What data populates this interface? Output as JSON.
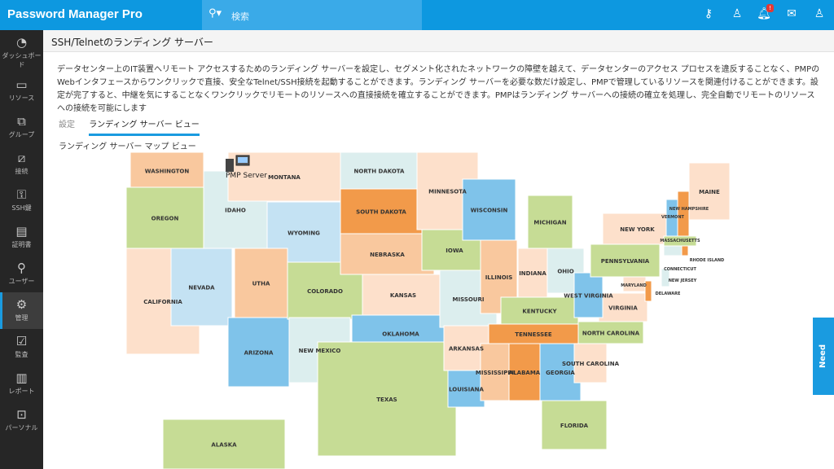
{
  "header": {
    "logo": "Password Manager Pro",
    "search_placeholder": "検索",
    "notification_count": "!"
  },
  "sidebar": {
    "items": [
      {
        "label": "ダッシュボード",
        "icon": "dashboard-icon",
        "glyph": "◔"
      },
      {
        "label": "リソース",
        "icon": "monitor-icon",
        "glyph": "▭"
      },
      {
        "label": "グループ",
        "icon": "groups-icon",
        "glyph": "⧉"
      },
      {
        "label": "接続",
        "icon": "connection-icon",
        "glyph": "⧄"
      },
      {
        "label": "SSH鍵",
        "icon": "ssh-key-icon",
        "glyph": "⚿"
      },
      {
        "label": "証明書",
        "icon": "certificate-icon",
        "glyph": "▤"
      },
      {
        "label": "ユーザー",
        "icon": "user-icon",
        "glyph": "⚲"
      },
      {
        "label": "管理",
        "icon": "gear-icon",
        "glyph": "⚙"
      },
      {
        "label": "監査",
        "icon": "clipboard-icon",
        "glyph": "☑"
      },
      {
        "label": "レポート",
        "icon": "report-icon",
        "glyph": "▥"
      },
      {
        "label": "パーソナル",
        "icon": "personal-icon",
        "glyph": "⊡"
      }
    ]
  },
  "page": {
    "title": "SSH/Telnetのランディング サーバー",
    "description": "データセンター上のIT装置へリモート アクセスするためのランディング サーバーを設定し、セグメント化されたネットワークの障壁を越えて、データセンターのアクセス プロセスを違反することなく、PMPのWebインタフェースからワンクリックで直接、安全なTelnet/SSH接続を起動することができます。ランディング サーバーを必要な数だけ設定し、PMPで管理しているリソースを関連付けることができます。設定が完了すると、中継を気にすることなくワンクリックでリモートのリソースへの直接接続を確立することができます。PMPはランディング サーバーへの接続の確立を処理し、完全自動でリモートのリソースへの接続を可能にします",
    "tabs": [
      "設定",
      "ランディング サーバー ビュー"
    ],
    "map_title": "ランディング サーバー マップ ビュー",
    "server_label": "PMP Server",
    "assist": "Need Assistance?"
  },
  "colors": {
    "peach": "#fde0cb",
    "lorange": "#f9c89e",
    "orange": "#f29a4a",
    "green": "#c6dc95",
    "lblue": "#c4e2f3",
    "blue": "#7fc3ea",
    "teal": "#dceeee"
  },
  "states": [
    [
      "WASHINGTON",
      "lorange"
    ],
    [
      "OREGON",
      "green"
    ],
    [
      "CALIFORNIA",
      "peach"
    ],
    [
      "NEVADA",
      "lblue"
    ],
    [
      "IDAHO",
      "teal"
    ],
    [
      "MONTANA",
      "peach"
    ],
    [
      "WYOMING",
      "lblue"
    ],
    [
      "UTHA",
      "lorange"
    ],
    [
      "ARIZONA",
      "blue"
    ],
    [
      "COLORADO",
      "green"
    ],
    [
      "NEW MEXICO",
      "teal"
    ],
    [
      "NORTH DAKOTA",
      "teal"
    ],
    [
      "SOUTH DAKOTA",
      "orange"
    ],
    [
      "NEBRASKA",
      "lorange"
    ],
    [
      "KANSAS",
      "peach"
    ],
    [
      "OKLAHOMA",
      "blue"
    ],
    [
      "TEXAS",
      "green"
    ],
    [
      "MINNESOTA",
      "peach"
    ],
    [
      "IOWA",
      "green"
    ],
    [
      "MISSOURI",
      "teal"
    ],
    [
      "ARKANSAS",
      "peach"
    ],
    [
      "LOUISIANA",
      "blue"
    ],
    [
      "WISCONSIN",
      "blue"
    ],
    [
      "ILLINOIS",
      "lorange"
    ],
    [
      "MICHIGAN",
      "green"
    ],
    [
      "INDIANA",
      "peach"
    ],
    [
      "OHIO",
      "teal"
    ],
    [
      "KENTUCKY",
      "green"
    ],
    [
      "TENNESSEE",
      "orange"
    ],
    [
      "MISSISSIPPI",
      "lorange"
    ],
    [
      "ALABAMA",
      "orange"
    ],
    [
      "GEORGIA",
      "blue"
    ],
    [
      "FLORIDA",
      "green"
    ],
    [
      "SOUTH CAROLINA",
      "peach"
    ],
    [
      "NORTH CAROLINA",
      "green"
    ],
    [
      "VIRGINIA",
      "peach"
    ],
    [
      "WEST VIRGINIA",
      "blue"
    ],
    [
      "PENNSYLVANIA",
      "green"
    ],
    [
      "NEW YORK",
      "peach"
    ],
    [
      "MARYLAND",
      "peach"
    ],
    [
      "DELAWARE",
      "orange"
    ],
    [
      "NEW JERSEY",
      "teal"
    ],
    [
      "VERMONT",
      "blue"
    ],
    [
      "NEW HAMPSHIRE",
      "orange"
    ],
    [
      "MAINE",
      "peach"
    ],
    [
      "MASSACHUSETTS",
      "green"
    ],
    [
      "CONNECTICUT",
      "teal"
    ],
    [
      "RHODE ISLAND",
      "orange"
    ],
    [
      "ALASKA",
      "green"
    ]
  ]
}
